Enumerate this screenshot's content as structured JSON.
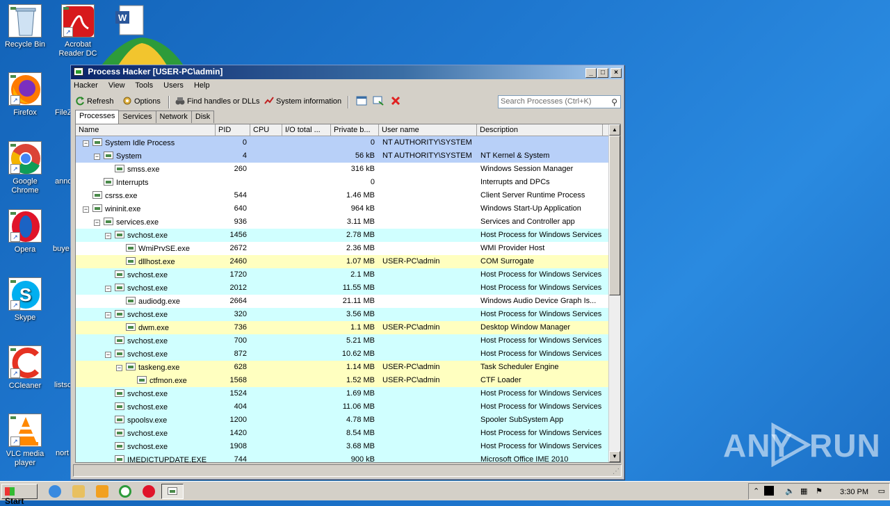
{
  "desktop": {
    "icons": [
      {
        "label": "Recycle Bin",
        "icon": "recycle-bin-icon"
      },
      {
        "label": "Acrobat Reader DC",
        "icon": "acrobat-icon"
      },
      {
        "label": "Firefox",
        "icon": "firefox-icon"
      },
      {
        "label": "Google Chrome",
        "icon": "chrome-icon"
      },
      {
        "label": "Opera",
        "icon": "opera-icon"
      },
      {
        "label": "Skype",
        "icon": "skype-icon"
      },
      {
        "label": "CCleaner",
        "icon": "ccleaner-icon"
      },
      {
        "label": "VLC media player",
        "icon": "vlc-icon"
      }
    ],
    "partial_labels": [
      "FileZ",
      "anno",
      "buye",
      "listsc",
      "nort"
    ],
    "watermark": {
      "left": "ANY",
      "right": "RUN"
    }
  },
  "window": {
    "title": "Process Hacker [USER-PC\\admin]",
    "menu": [
      "Hacker",
      "View",
      "Tools",
      "Users",
      "Help"
    ],
    "toolbar": {
      "refresh": "Refresh",
      "options": "Options",
      "find_handles": "Find handles or DLLs",
      "system_info": "System information"
    },
    "search_placeholder": "Search Processes (Ctrl+K)",
    "tabs": [
      "Processes",
      "Services",
      "Network",
      "Disk"
    ],
    "columns": [
      "Name",
      "PID",
      "CPU",
      "I/O total ...",
      "Private b...",
      "User name",
      "Description"
    ],
    "processes": [
      {
        "name": "System Idle Process",
        "pid": "0",
        "cpu": "",
        "io": "",
        "priv": "0",
        "user": "NT AUTHORITY\\SYSTEM",
        "desc": "",
        "level": 0,
        "toggle": "⊟",
        "color": "#b8d0f8"
      },
      {
        "name": "System",
        "pid": "4",
        "cpu": "",
        "io": "",
        "priv": "56 kB",
        "user": "NT AUTHORITY\\SYSTEM",
        "desc": "NT Kernel & System",
        "level": 1,
        "toggle": "⊟",
        "color": "#b8d0f8"
      },
      {
        "name": "smss.exe",
        "pid": "260",
        "cpu": "",
        "io": "",
        "priv": "316 kB",
        "user": "",
        "desc": "Windows Session Manager",
        "level": 2,
        "toggle": "",
        "color": "#ffffff"
      },
      {
        "name": "Interrupts",
        "pid": "",
        "cpu": "",
        "io": "",
        "priv": "0",
        "user": "",
        "desc": "Interrupts and DPCs",
        "level": 1,
        "toggle": "",
        "color": "#ffffff"
      },
      {
        "name": "csrss.exe",
        "pid": "544",
        "cpu": "",
        "io": "",
        "priv": "1.46 MB",
        "user": "",
        "desc": "Client Server Runtime Process",
        "level": 0,
        "toggle": "",
        "color": "#ffffff"
      },
      {
        "name": "wininit.exe",
        "pid": "640",
        "cpu": "",
        "io": "",
        "priv": "964 kB",
        "user": "",
        "desc": "Windows Start-Up Application",
        "level": 0,
        "toggle": "⊟",
        "color": "#ffffff"
      },
      {
        "name": "services.exe",
        "pid": "936",
        "cpu": "",
        "io": "",
        "priv": "3.11 MB",
        "user": "",
        "desc": "Services and Controller app",
        "level": 1,
        "toggle": "⊟",
        "color": "#ffffff"
      },
      {
        "name": "svchost.exe",
        "pid": "1456",
        "cpu": "",
        "io": "",
        "priv": "2.78 MB",
        "user": "",
        "desc": "Host Process for Windows Services",
        "level": 2,
        "toggle": "⊟",
        "color": "#d0ffff"
      },
      {
        "name": "WmiPrvSE.exe",
        "pid": "2672",
        "cpu": "",
        "io": "",
        "priv": "2.36 MB",
        "user": "",
        "desc": "WMI Provider Host",
        "level": 3,
        "toggle": "",
        "color": "#ffffff"
      },
      {
        "name": "dllhost.exe",
        "pid": "2460",
        "cpu": "",
        "io": "",
        "priv": "1.07 MB",
        "user": "USER-PC\\admin",
        "desc": "COM Surrogate",
        "level": 3,
        "toggle": "",
        "color": "#ffffc0"
      },
      {
        "name": "svchost.exe",
        "pid": "1720",
        "cpu": "",
        "io": "",
        "priv": "2.1 MB",
        "user": "",
        "desc": "Host Process for Windows Services",
        "level": 2,
        "toggle": "",
        "color": "#d0ffff"
      },
      {
        "name": "svchost.exe",
        "pid": "2012",
        "cpu": "",
        "io": "",
        "priv": "11.55 MB",
        "user": "",
        "desc": "Host Process for Windows Services",
        "level": 2,
        "toggle": "⊟",
        "color": "#d0ffff"
      },
      {
        "name": "audiodg.exe",
        "pid": "2664",
        "cpu": "",
        "io": "",
        "priv": "21.11 MB",
        "user": "",
        "desc": "Windows Audio Device Graph Is...",
        "level": 3,
        "toggle": "",
        "color": "#ffffff"
      },
      {
        "name": "svchost.exe",
        "pid": "320",
        "cpu": "",
        "io": "",
        "priv": "3.56 MB",
        "user": "",
        "desc": "Host Process for Windows Services",
        "level": 2,
        "toggle": "⊟",
        "color": "#d0ffff"
      },
      {
        "name": "dwm.exe",
        "pid": "736",
        "cpu": "",
        "io": "",
        "priv": "1.1 MB",
        "user": "USER-PC\\admin",
        "desc": "Desktop Window Manager",
        "level": 3,
        "toggle": "",
        "color": "#ffffc0"
      },
      {
        "name": "svchost.exe",
        "pid": "700",
        "cpu": "",
        "io": "",
        "priv": "5.21 MB",
        "user": "",
        "desc": "Host Process for Windows Services",
        "level": 2,
        "toggle": "",
        "color": "#d0ffff"
      },
      {
        "name": "svchost.exe",
        "pid": "872",
        "cpu": "",
        "io": "",
        "priv": "10.62 MB",
        "user": "",
        "desc": "Host Process for Windows Services",
        "level": 2,
        "toggle": "⊟",
        "color": "#d0ffff"
      },
      {
        "name": "taskeng.exe",
        "pid": "628",
        "cpu": "",
        "io": "",
        "priv": "1.14 MB",
        "user": "USER-PC\\admin",
        "desc": "Task Scheduler Engine",
        "level": 3,
        "toggle": "⊟",
        "color": "#ffffc0"
      },
      {
        "name": "ctfmon.exe",
        "pid": "1568",
        "cpu": "",
        "io": "",
        "priv": "1.52 MB",
        "user": "USER-PC\\admin",
        "desc": "CTF Loader",
        "level": 4,
        "toggle": "",
        "color": "#ffffc0"
      },
      {
        "name": "svchost.exe",
        "pid": "1524",
        "cpu": "",
        "io": "",
        "priv": "1.69 MB",
        "user": "",
        "desc": "Host Process for Windows Services",
        "level": 2,
        "toggle": "",
        "color": "#d0ffff"
      },
      {
        "name": "svchost.exe",
        "pid": "404",
        "cpu": "",
        "io": "",
        "priv": "11.06 MB",
        "user": "",
        "desc": "Host Process for Windows Services",
        "level": 2,
        "toggle": "",
        "color": "#d0ffff"
      },
      {
        "name": "spoolsv.exe",
        "pid": "1200",
        "cpu": "",
        "io": "",
        "priv": "4.78 MB",
        "user": "",
        "desc": "Spooler SubSystem App",
        "level": 2,
        "toggle": "",
        "color": "#d0ffff"
      },
      {
        "name": "svchost.exe",
        "pid": "1420",
        "cpu": "",
        "io": "",
        "priv": "8.54 MB",
        "user": "",
        "desc": "Host Process for Windows Services",
        "level": 2,
        "toggle": "",
        "color": "#d0ffff"
      },
      {
        "name": "svchost.exe",
        "pid": "1908",
        "cpu": "",
        "io": "",
        "priv": "3.68 MB",
        "user": "",
        "desc": "Host Process for Windows Services",
        "level": 2,
        "toggle": "",
        "color": "#d0ffff"
      },
      {
        "name": "IMEDICTUPDATE.EXE",
        "pid": "744",
        "cpu": "",
        "io": "",
        "priv": "900 kB",
        "user": "",
        "desc": "Microsoft Office IME 2010",
        "level": 2,
        "toggle": "",
        "color": "#d0ffff"
      }
    ]
  },
  "taskbar": {
    "start_label": "Start",
    "clock": "3:30 PM"
  }
}
